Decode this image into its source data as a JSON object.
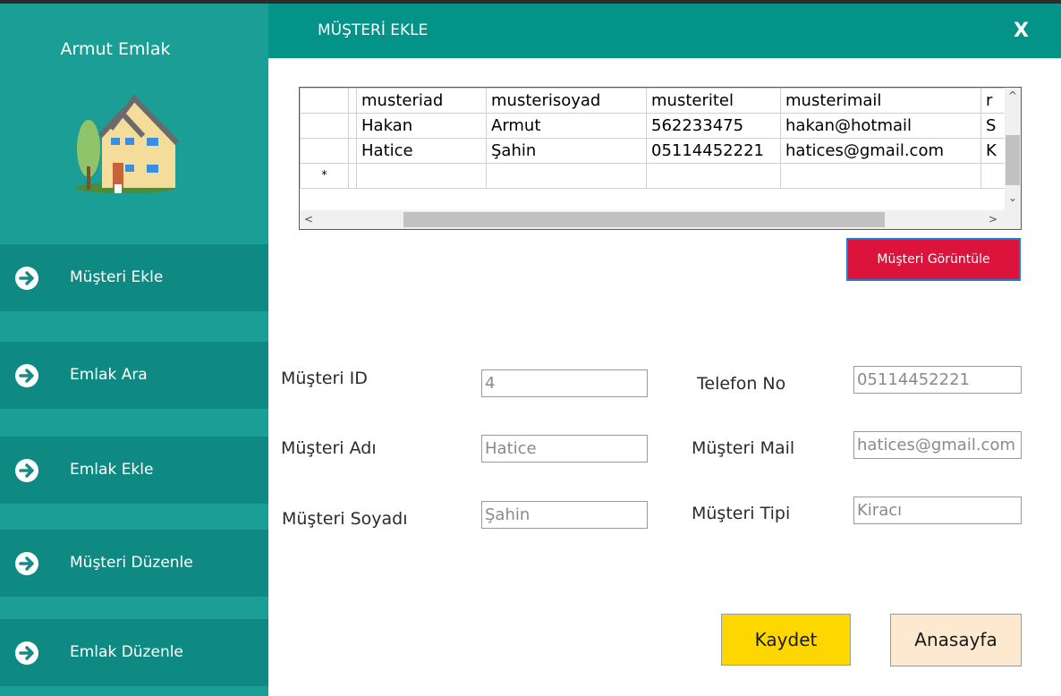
{
  "app": {
    "brand": "Armut Emlak"
  },
  "sidebar": {
    "items": [
      {
        "label": "Müşteri Ekle"
      },
      {
        "label": "Emlak Ara"
      },
      {
        "label": "Emlak Ekle"
      },
      {
        "label": "Müşteri Düzenle"
      },
      {
        "label": "Emlak Düzenle"
      }
    ]
  },
  "header": {
    "title": "MÜŞTERİ EKLE",
    "close": "X"
  },
  "grid": {
    "columns": [
      "musteriad",
      "musterisoyad",
      "musteritel",
      "musterimail",
      "r"
    ],
    "rows": [
      [
        "Hakan",
        "Armut",
        "562233475",
        "hakan@hotmail",
        "S"
      ],
      [
        "Hatice",
        "Şahin",
        "05114452221",
        "hatices@gmail.com",
        "K"
      ]
    ],
    "new_row_marker": "*"
  },
  "buttons": {
    "view": "Müşteri Görüntüle",
    "save": "Kaydet",
    "home": "Anasayfa"
  },
  "form": {
    "id_label": "Müşteri ID",
    "id_value": "4",
    "ad_label": "Müşteri Adı",
    "ad_value": "Hatice",
    "soyad_label": "Müşteri Soyadı",
    "soyad_value": "Şahin",
    "tel_label": "Telefon No",
    "tel_value": "05114452221",
    "mail_label": "Müşteri Mail",
    "mail_value": "hatices@gmail.com",
    "tip_label": "Müşteri Tipi",
    "tip_value": "Kiracı"
  },
  "colors": {
    "sidebar": "#1a9e96",
    "nav_item": "#0f8a83",
    "header": "#039389",
    "view_button": "#dc143c",
    "save_button": "#ffd700",
    "home_button": "#fde9cf"
  },
  "icons": {
    "logo": "house-icon",
    "nav": "arrow-right-circle-icon"
  }
}
